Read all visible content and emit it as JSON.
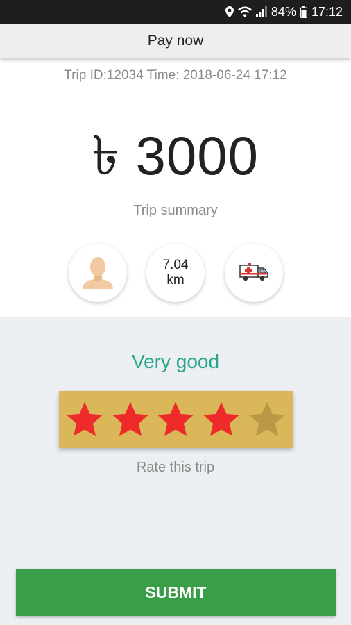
{
  "status_bar": {
    "battery": "84%",
    "time": "17:12"
  },
  "header": {
    "title": "Pay now"
  },
  "trip": {
    "meta": "Trip ID:12034 Time: 2018-06-24 17:12",
    "amount": "৳ 3000",
    "summary_label": "Trip summary",
    "distance_value": "7.04",
    "distance_unit": "km"
  },
  "rating": {
    "text": "Very good",
    "value": 4,
    "max": 5,
    "label": "Rate this trip",
    "filled_color": "#ee2a2a",
    "empty_color": "#b99847"
  },
  "actions": {
    "submit_label": "SUBMIT"
  },
  "icons": [
    "location-icon",
    "wifi-icon",
    "signal-icon",
    "battery-icon",
    "driver-avatar-icon",
    "ambulance-icon",
    "star-icon"
  ],
  "colors": {
    "accent": "#26a68a",
    "button": "#3a9d48",
    "stars_bg": "#dab85a"
  }
}
